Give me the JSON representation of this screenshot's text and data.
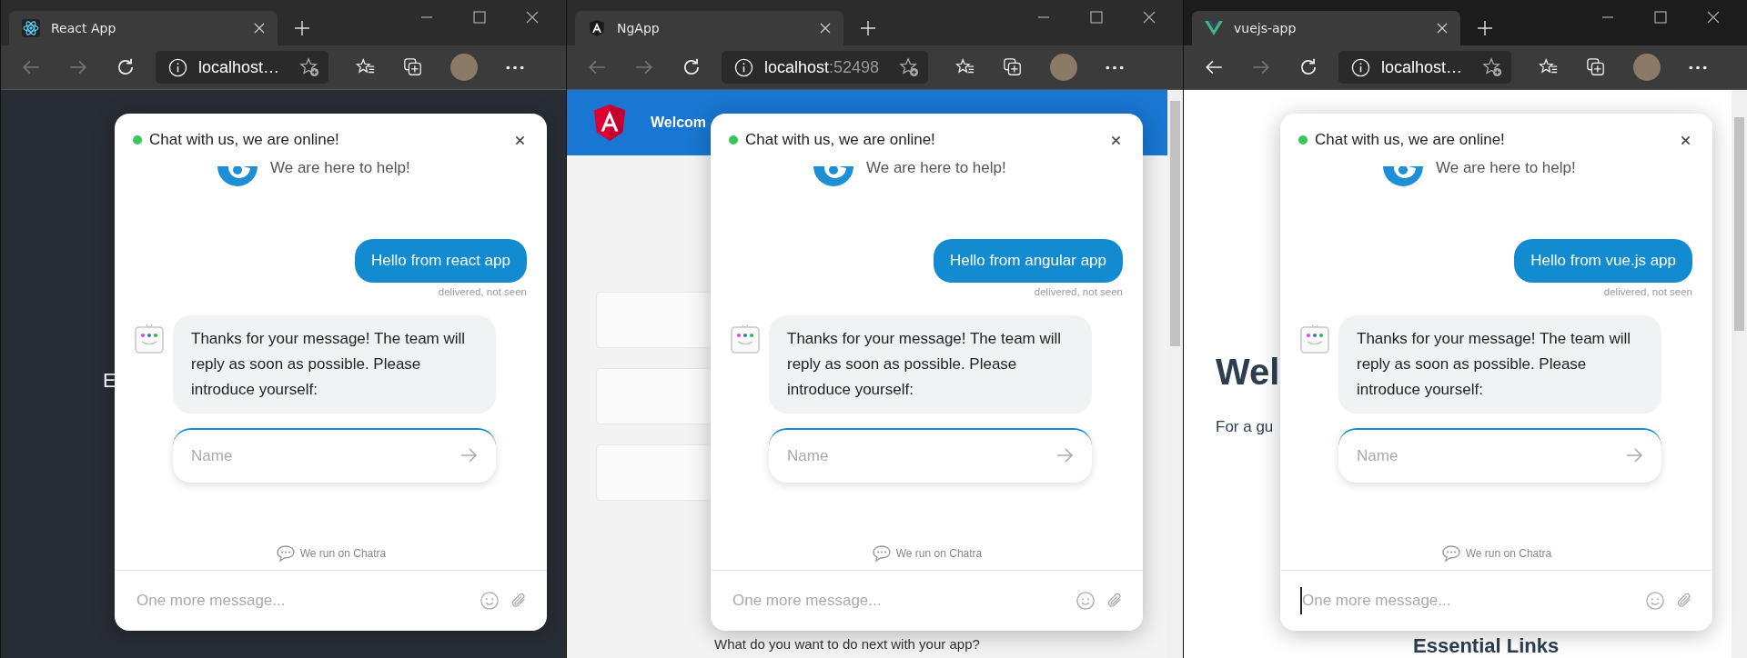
{
  "windows": [
    {
      "kind": "react",
      "active": false,
      "back_enabled": false,
      "tab": {
        "title": "React App"
      },
      "address": {
        "host": "localhost…"
      },
      "page": {
        "text": "E"
      },
      "chat": {
        "online": true,
        "title": "Chat with us, we are online!",
        "help_text": "We are here to help!",
        "messages": [
          {
            "kind": "user",
            "text": "Hello from react app",
            "status": "delivered, not seen"
          },
          {
            "kind": "bot",
            "text": "Thanks for your message! The team will reply as soon as possible. Please introduce yourself:"
          }
        ],
        "name_field": {
          "placeholder": "Name"
        },
        "powered_by": "We run on Chatra",
        "composer": {
          "placeholder": "One more message...",
          "focused": false
        }
      }
    },
    {
      "kind": "angular",
      "active": false,
      "back_enabled": false,
      "tab": {
        "title": "NgApp"
      },
      "address": {
        "host": "localhost",
        "port": ":52498"
      },
      "page": {
        "banner_title": "Welcom",
        "bottom_text": "What do you want to do next with your app?"
      },
      "chat": {
        "online": true,
        "title": "Chat with us, we are online!",
        "help_text": "We are here to help!",
        "messages": [
          {
            "kind": "user",
            "text": "Hello from angular app",
            "status": "delivered, not seen"
          },
          {
            "kind": "bot",
            "text": "Thanks for your message! The team will reply as soon as possible. Please introduce yourself:"
          }
        ],
        "name_field": {
          "placeholder": "Name"
        },
        "powered_by": "We run on Chatra",
        "composer": {
          "placeholder": "One more message...",
          "focused": false
        }
      }
    },
    {
      "kind": "vue",
      "active": true,
      "back_enabled": true,
      "tab": {
        "title": "vuejs-app"
      },
      "address": {
        "host": "localhost…"
      },
      "page": {
        "heading": "Wel",
        "lead": "For a gu",
        "section_title": "Essential Links"
      },
      "chat": {
        "online": true,
        "title": "Chat with us, we are online!",
        "help_text": "We are here to help!",
        "messages": [
          {
            "kind": "user",
            "text": "Hello from vue.js app",
            "status": "delivered, not seen"
          },
          {
            "kind": "bot",
            "text": "Thanks for your message! The team will reply as soon as possible. Please introduce yourself:"
          }
        ],
        "name_field": {
          "placeholder": "Name"
        },
        "powered_by": "We run on Chatra",
        "composer": {
          "placeholder": "One more message...",
          "focused": true
        }
      }
    }
  ]
}
